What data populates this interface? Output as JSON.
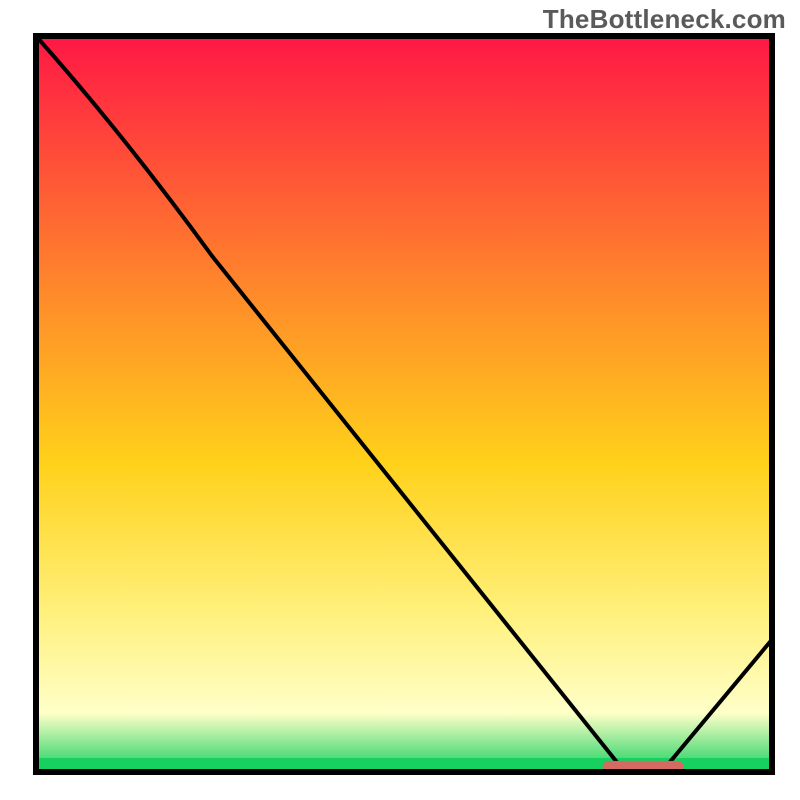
{
  "watermark": "TheBottleneck.com",
  "chart_data": {
    "type": "line",
    "title": "",
    "xlabel": "",
    "ylabel": "",
    "xlim": [
      0,
      100
    ],
    "ylim": [
      0,
      100
    ],
    "x": [
      0,
      24,
      80,
      85,
      100
    ],
    "values": [
      100,
      70,
      0,
      0,
      18
    ],
    "grid": false,
    "legend": false,
    "colors": {
      "gradient_top": "#ff1745",
      "gradient_mid_upper": "#ff8a2a",
      "gradient_mid": "#ffd11a",
      "gradient_mid_lower": "#fff07a",
      "gradient_low": "#ffffc8",
      "gradient_bottom": "#18d060",
      "line": "#000000",
      "marker": "#d46a62"
    },
    "marker": {
      "x_start": 77,
      "x_end": 88,
      "y": 0.7
    }
  }
}
